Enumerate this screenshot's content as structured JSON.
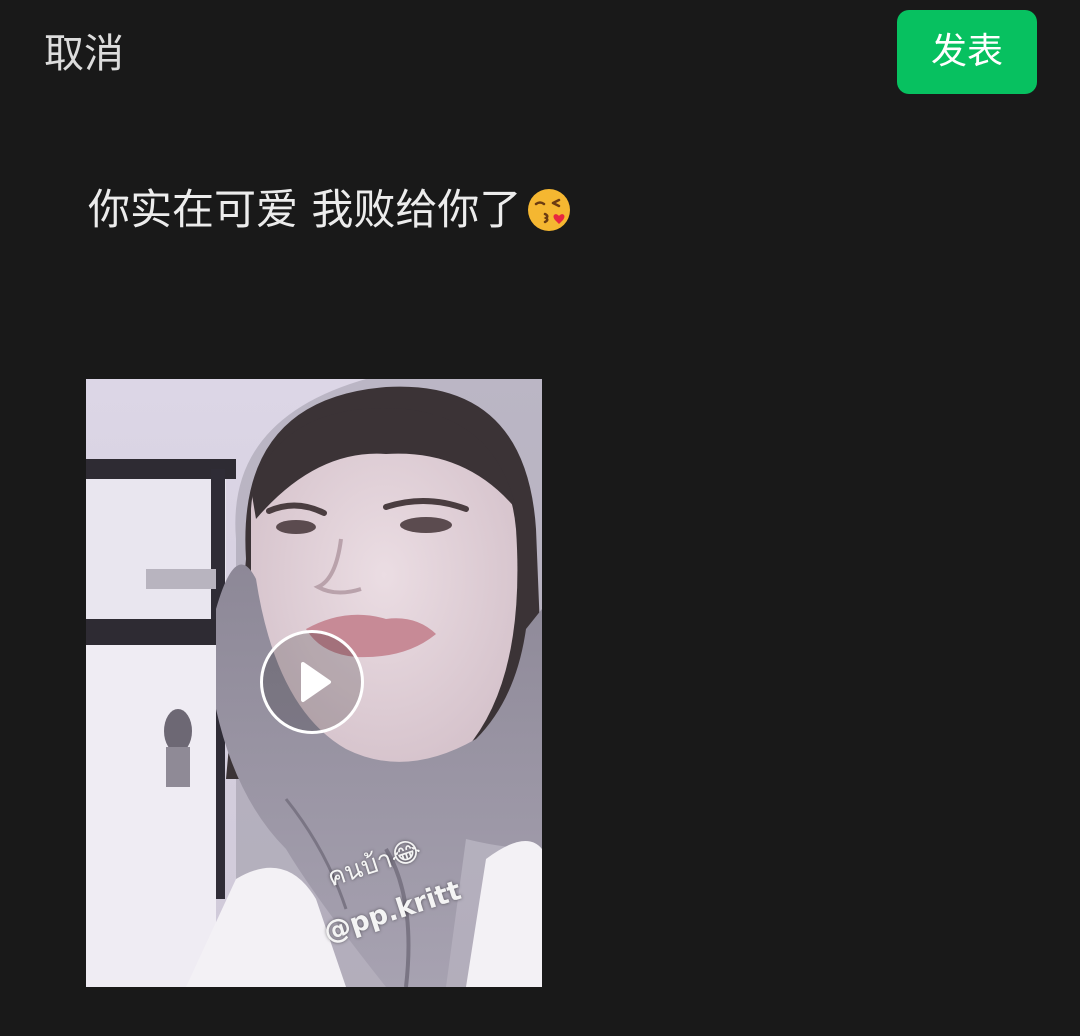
{
  "header": {
    "cancel_label": "取消",
    "publish_label": "发表",
    "publish_color": "#07c160"
  },
  "post": {
    "text": "你实在可爱 我败给你了",
    "emoji": "face-blowing-kiss-icon"
  },
  "video": {
    "play_icon": "play-icon",
    "overlay_text_1": "คนบ้า😂",
    "overlay_text_2": "@pp.kritt"
  },
  "colors": {
    "background": "#191919",
    "text": "#ececec"
  }
}
